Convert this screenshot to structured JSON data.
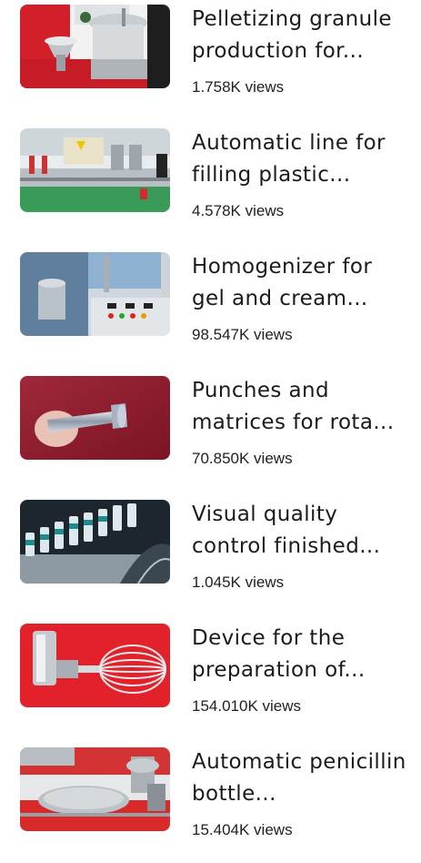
{
  "videos": [
    {
      "title": "Pelletizing granule production for...",
      "views": "1.758K views",
      "thumb_icon": "granulator-machine-thumbnail",
      "accent": "#d8202a"
    },
    {
      "title": "Automatic line for filling plastic...",
      "views": "4.578K views",
      "thumb_icon": "filling-line-thumbnail",
      "accent": "#2e8a4a"
    },
    {
      "title": "Homogenizer for gel and cream...",
      "views": "98.547K views",
      "thumb_icon": "homogenizer-thumbnail",
      "accent": "#6a8fb8"
    },
    {
      "title": "Punches and matrices for rota...",
      "views": "70.850K views",
      "thumb_icon": "punch-tool-thumbnail",
      "accent": "#9a1f2e"
    },
    {
      "title": "Visual quality control finished...",
      "views": "1.045K views",
      "thumb_icon": "vial-inspection-thumbnail",
      "accent": "#1c2a33"
    },
    {
      "title": "Device for the preparation of...",
      "views": "154.010K views",
      "thumb_icon": "whisk-device-thumbnail",
      "accent": "#e0232b"
    },
    {
      "title": "Automatic penicillin bottle...",
      "views": "15.404K views",
      "thumb_icon": "bottle-machine-thumbnail",
      "accent": "#d92a2a"
    }
  ]
}
